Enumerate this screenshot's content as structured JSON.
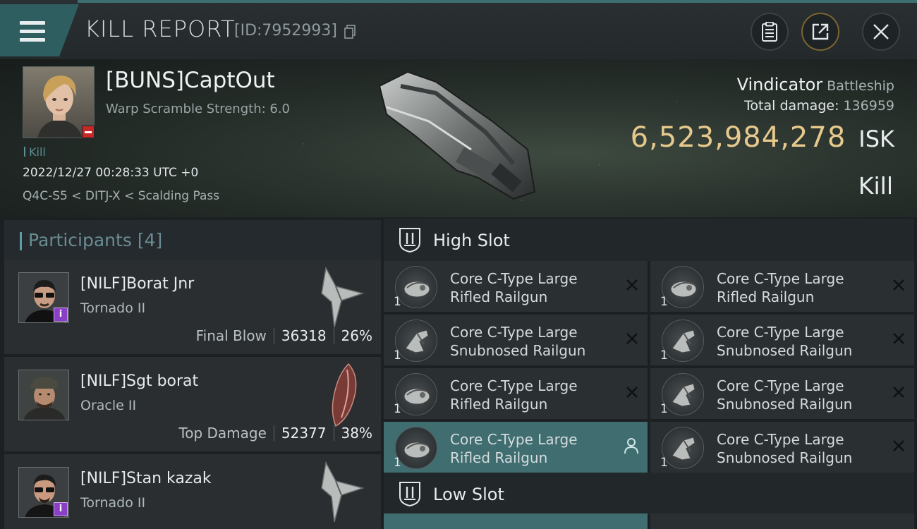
{
  "window": {
    "title": "KILL REPORT",
    "report_id": "[ID:7952993]"
  },
  "header_buttons": {
    "report_icon": "clipboard-icon",
    "share_icon": "share-icon",
    "close_icon": "close-icon"
  },
  "victim": {
    "name": "[BUNS]CaptOut",
    "warp_scramble": "Warp Scramble Strength: 6.0",
    "tag": "Kill",
    "time": "2022/12/27 00:28:33 UTC +0",
    "location": "Q4C-S5 < DITJ-X < Scalding Pass",
    "ship_name": "Vindicator",
    "ship_class": "Battleship",
    "total_damage_label": "Total damage:",
    "total_damage": "136959",
    "isk_value": "6,523,984,278",
    "isk_unit": "ISK",
    "result": "Kill"
  },
  "participants": {
    "label": "Participants",
    "count": "[4]",
    "items": [
      {
        "name": "[NILF]Borat Jnr",
        "ship": "Tornado II",
        "stat_label": "Final Blow",
        "damage": "36318",
        "percent": "26%",
        "badge": "i"
      },
      {
        "name": "[NILF]Sgt borat",
        "ship": "Oracle II",
        "stat_label": "Top Damage",
        "damage": "52377",
        "percent": "38%",
        "badge": ""
      },
      {
        "name": "[NILF]Stan kazak",
        "ship": "Tornado II",
        "stat_label": "",
        "damage": "",
        "percent": "",
        "badge": "i"
      }
    ]
  },
  "fitting": {
    "high_slot_label": "High Slot",
    "low_slot_label": "Low Slot",
    "high_modules": [
      {
        "line1": "Core C-Type Large",
        "line2": "Rifled Railgun",
        "qty": "1",
        "state": "destroyed"
      },
      {
        "line1": "Core C-Type Large",
        "line2": "Rifled Railgun",
        "qty": "1",
        "state": "destroyed"
      },
      {
        "line1": "Core C-Type Large",
        "line2": "Snubnosed Railgun",
        "qty": "1",
        "state": "destroyed"
      },
      {
        "line1": "Core C-Type Large",
        "line2": "Snubnosed Railgun",
        "qty": "1",
        "state": "destroyed"
      },
      {
        "line1": "Core C-Type Large",
        "line2": "Rifled Railgun",
        "qty": "1",
        "state": "destroyed"
      },
      {
        "line1": "Core C-Type Large",
        "line2": "Snubnosed Railgun",
        "qty": "1",
        "state": "destroyed"
      },
      {
        "line1": "Core C-Type Large",
        "line2": "Rifled Railgun",
        "qty": "1",
        "state": "dropped"
      },
      {
        "line1": "Core C-Type Large",
        "line2": "Snubnosed Railgun",
        "qty": "1",
        "state": "destroyed"
      }
    ]
  },
  "colors": {
    "accent_teal": "#3f6d70",
    "isk_gold": "#e6c98d",
    "badge_purple": "#8a3fc4",
    "badge_red": "#c62828"
  }
}
